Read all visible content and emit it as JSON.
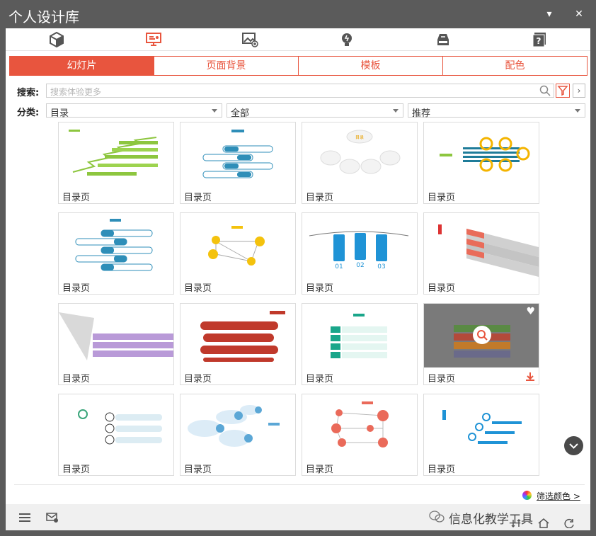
{
  "window": {
    "title": "个人设计库"
  },
  "title_buttons": {
    "pin": "▾",
    "close": "✕"
  },
  "icon_tabs": [
    "cube-icon",
    "presentation-icon",
    "image-add-icon",
    "lightbulb-icon",
    "storage-icon",
    "help-book-icon"
  ],
  "tabs": [
    {
      "label": "幻灯片",
      "active": true
    },
    {
      "label": "页面背景",
      "active": false
    },
    {
      "label": "模板",
      "active": false
    },
    {
      "label": "配色",
      "active": false
    }
  ],
  "search": {
    "label": "搜索:",
    "placeholder": "搜索体验更多"
  },
  "filters": {
    "label": "分类:",
    "category": "目录",
    "scope": "全部",
    "sort": "推荐"
  },
  "cards": [
    {
      "caption": "目录页"
    },
    {
      "caption": "目录页"
    },
    {
      "caption": "目录页"
    },
    {
      "caption": "目录页"
    },
    {
      "caption": "目录页"
    },
    {
      "caption": "目录页"
    },
    {
      "caption": "目录页"
    },
    {
      "caption": "目录页"
    },
    {
      "caption": "目录页"
    },
    {
      "caption": "目录页"
    },
    {
      "caption": "目录页"
    },
    {
      "caption": "目录页"
    },
    {
      "caption": "目录页"
    },
    {
      "caption": "目录页"
    },
    {
      "caption": "目录页"
    },
    {
      "caption": "目录页"
    }
  ],
  "color_filter": {
    "label": "筛选颜色 >"
  },
  "watermark": {
    "text": "信息化教学工具"
  },
  "colors": {
    "accent": "#e8553e",
    "titlebar": "#5b5b5b"
  }
}
